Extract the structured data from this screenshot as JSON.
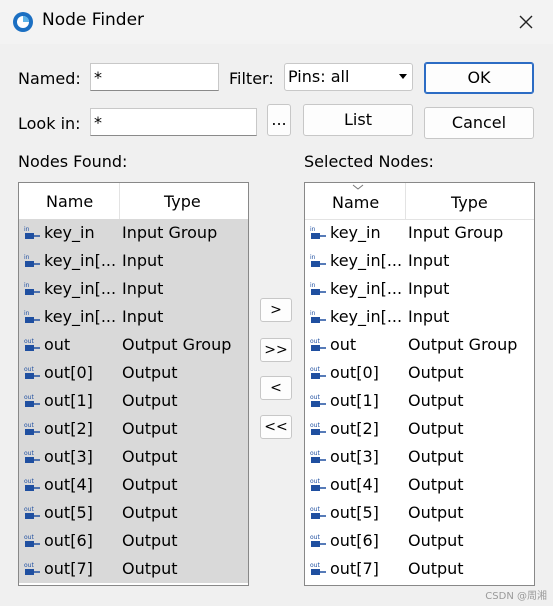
{
  "window": {
    "title": "Node Finder"
  },
  "form": {
    "named_label": "Named:",
    "named_value": "*",
    "filter_label": "Filter:",
    "filter_value": "Pins: all",
    "lookin_label": "Look in:",
    "lookin_value": "*",
    "browse_label": "...",
    "list_label": "List",
    "ok_label": "OK",
    "cancel_label": "Cancel"
  },
  "nodes_found": {
    "label": "Nodes Found:",
    "col_name": "Name",
    "col_type": "Type",
    "rows": [
      {
        "name": "key_in",
        "type": "Input Group",
        "pin": "in"
      },
      {
        "name": "key_in[...",
        "type": "Input",
        "pin": "in"
      },
      {
        "name": "key_in[...",
        "type": "Input",
        "pin": "in"
      },
      {
        "name": "key_in[...",
        "type": "Input",
        "pin": "in"
      },
      {
        "name": "out",
        "type": "Output Group",
        "pin": "out"
      },
      {
        "name": "out[0]",
        "type": "Output",
        "pin": "out"
      },
      {
        "name": "out[1]",
        "type": "Output",
        "pin": "out"
      },
      {
        "name": "out[2]",
        "type": "Output",
        "pin": "out"
      },
      {
        "name": "out[3]",
        "type": "Output",
        "pin": "out"
      },
      {
        "name": "out[4]",
        "type": "Output",
        "pin": "out"
      },
      {
        "name": "out[5]",
        "type": "Output",
        "pin": "out"
      },
      {
        "name": "out[6]",
        "type": "Output",
        "pin": "out"
      },
      {
        "name": "out[7]",
        "type": "Output",
        "pin": "out"
      }
    ]
  },
  "transfer": {
    "add_one": ">",
    "add_all": ">>",
    "remove_one": "<",
    "remove_all": "<<"
  },
  "selected_nodes": {
    "label": "Selected Nodes:",
    "col_name": "Name",
    "col_type": "Type",
    "rows": [
      {
        "name": "key_in",
        "type": "Input Group",
        "pin": "in"
      },
      {
        "name": "key_in[...",
        "type": "Input",
        "pin": "in"
      },
      {
        "name": "key_in[...",
        "type": "Input",
        "pin": "in"
      },
      {
        "name": "key_in[...",
        "type": "Input",
        "pin": "in"
      },
      {
        "name": "out",
        "type": "Output Group",
        "pin": "out"
      },
      {
        "name": "out[0]",
        "type": "Output",
        "pin": "out"
      },
      {
        "name": "out[1]",
        "type": "Output",
        "pin": "out"
      },
      {
        "name": "out[2]",
        "type": "Output",
        "pin": "out"
      },
      {
        "name": "out[3]",
        "type": "Output",
        "pin": "out"
      },
      {
        "name": "out[4]",
        "type": "Output",
        "pin": "out"
      },
      {
        "name": "out[5]",
        "type": "Output",
        "pin": "out"
      },
      {
        "name": "out[6]",
        "type": "Output",
        "pin": "out"
      },
      {
        "name": "out[7]",
        "type": "Output",
        "pin": "out"
      }
    ]
  },
  "watermark": "CSDN @周湘",
  "colors": {
    "pin_icon": "#1f4fa0",
    "selected_row": "#d9d9d9",
    "default_button": "#2c6cc4"
  }
}
